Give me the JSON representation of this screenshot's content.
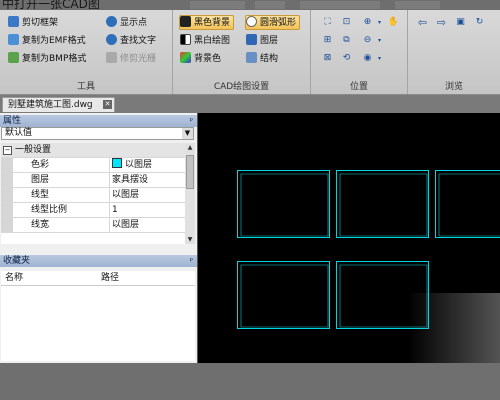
{
  "title_text": "中打开一张CAD图",
  "ribbon": {
    "tools": {
      "label": "工具",
      "buttons": [
        {
          "label": "剪切框架",
          "icon": "scissors-frame-icon"
        },
        {
          "label": "复制为EMF格式",
          "icon": "copy-emf-icon"
        },
        {
          "label": "复制为BMP格式",
          "icon": "copy-bmp-icon"
        },
        {
          "label": "显示点",
          "icon": "show-points-icon"
        },
        {
          "label": "查找文字",
          "icon": "find-text-icon"
        },
        {
          "label": "修剪光栅",
          "icon": "trim-raster-icon"
        }
      ]
    },
    "cad_settings": {
      "label": "CAD绘图设置",
      "buttons": [
        {
          "label": "黑色背景",
          "icon": "black-background-icon"
        },
        {
          "label": "黑白绘图",
          "icon": "black-white-icon"
        },
        {
          "label": "背景色",
          "icon": "background-color-icon"
        },
        {
          "label": "圆滑弧形",
          "icon": "smooth-arc-icon"
        },
        {
          "label": "图层",
          "icon": "layers-icon"
        },
        {
          "label": "结构",
          "icon": "structure-icon"
        }
      ]
    },
    "position": {
      "label": "位置"
    },
    "browse": {
      "label": "浏览"
    }
  },
  "document_tab": {
    "label": "别墅建筑施工图.dwg"
  },
  "properties_panel": {
    "title": "属性",
    "pin": "ᵖ",
    "dropdown_value": "默认值",
    "category": "一般设置",
    "rows": [
      {
        "key": "色彩",
        "value": "以图层",
        "swatch": "#00e5ff"
      },
      {
        "key": "图层",
        "value": "家具摆设"
      },
      {
        "key": "线型",
        "value": "以图层"
      },
      {
        "key": "线型比例",
        "value": "1"
      },
      {
        "key": "线宽",
        "value": "以图层"
      }
    ]
  },
  "favorites_panel": {
    "title": "收藏夹",
    "pin": "ᵖ",
    "columns": [
      "名称",
      "路径"
    ]
  },
  "colors": {
    "ribbon": "#d2d2d2",
    "canvas": "#000000",
    "sheet_border": "#00d6e0",
    "active_button": "#f6cf74"
  }
}
